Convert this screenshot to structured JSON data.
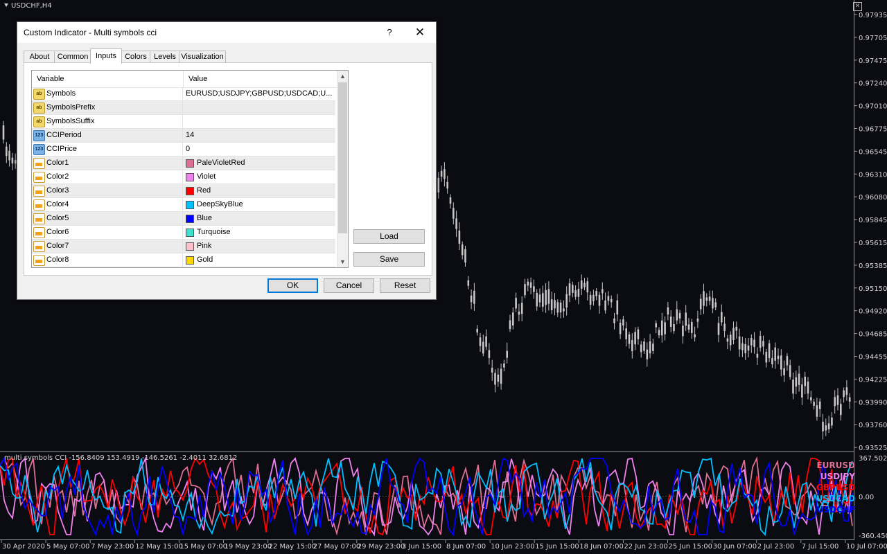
{
  "chart": {
    "symbol": "USDCHF,H4",
    "price_labels": [
      "0.97935",
      "0.97705",
      "0.97475",
      "0.97240",
      "0.97010",
      "0.96775",
      "0.96545",
      "0.96310",
      "0.96080",
      "0.95845",
      "0.95615",
      "0.95385",
      "0.95150",
      "0.94920",
      "0.94685",
      "0.94455",
      "0.94225",
      "0.93990",
      "0.93760",
      "0.93525"
    ],
    "date_labels": [
      "30 Apr 2020",
      "5 May 07:00",
      "7 May 23:00",
      "12 May 15:00",
      "15 May 07:00",
      "19 May 23:00",
      "22 May 15:00",
      "27 May 07:00",
      "29 May 23:00",
      "3 Jun 15:00",
      "8 Jun 07:00",
      "10 Jun 23:00",
      "15 Jun 15:00",
      "18 Jun 07:00",
      "22 Jun 23:00",
      "25 Jun 15:00",
      "30 Jun 07:00",
      "2 Jul 23:00",
      "7 Jul 15:00",
      "10 Jul 07:00"
    ],
    "indicator_label": "multi symbols CCI -156.8409 153.4919 -146.5261 -2.4011 32.6812",
    "indicator_scale": [
      "367.5023",
      "0.00",
      "-360.4502"
    ],
    "legend": [
      {
        "name": "EURUSD",
        "color": "#DB7093"
      },
      {
        "name": "USDJPY",
        "color": "#EE82EE"
      },
      {
        "name": "GBPUSD",
        "color": "#FF0000"
      },
      {
        "name": "USDCAD",
        "color": "#00BFFF"
      },
      {
        "name": "USDCHF",
        "color": "#0000FF"
      }
    ],
    "candle_color": "#c8c8c8"
  },
  "dialog": {
    "title": "Custom Indicator - Multi symbols cci",
    "help_label": "?",
    "close_label": "✕",
    "tabs": [
      {
        "label": "About",
        "active": false
      },
      {
        "label": "Common",
        "active": false
      },
      {
        "label": "Inputs",
        "active": true
      },
      {
        "label": "Colors",
        "active": false
      },
      {
        "label": "Levels",
        "active": false
      },
      {
        "label": "Visualization",
        "active": false
      }
    ],
    "grid": {
      "col_variable": "Variable",
      "col_value": "Value",
      "rows": [
        {
          "icon": "ab",
          "name": "Symbols",
          "value": "EURUSD;USDJPY;GBPUSD;USDCAD;U..."
        },
        {
          "icon": "ab",
          "name": "SymbolsPrefix",
          "value": ""
        },
        {
          "icon": "ab",
          "name": "SymbolsSuffix",
          "value": ""
        },
        {
          "icon": "num",
          "name": "CCIPeriod",
          "value": "14"
        },
        {
          "icon": "num",
          "name": "CCIPrice",
          "value": "0"
        },
        {
          "icon": "clr",
          "name": "Color1",
          "value": "PaleVioletRed",
          "swatch": "#DB7093"
        },
        {
          "icon": "clr",
          "name": "Color2",
          "value": "Violet",
          "swatch": "#EE82EE"
        },
        {
          "icon": "clr",
          "name": "Color3",
          "value": "Red",
          "swatch": "#FF0000"
        },
        {
          "icon": "clr",
          "name": "Color4",
          "value": "DeepSkyBlue",
          "swatch": "#00BFFF"
        },
        {
          "icon": "clr",
          "name": "Color5",
          "value": "Blue",
          "swatch": "#0000FF"
        },
        {
          "icon": "clr",
          "name": "Color6",
          "value": "Turquoise",
          "swatch": "#40E0D0"
        },
        {
          "icon": "clr",
          "name": "Color7",
          "value": "Pink",
          "swatch": "#FFC0CB"
        },
        {
          "icon": "clr",
          "name": "Color8",
          "value": "Gold",
          "swatch": "#FFD700"
        }
      ]
    },
    "load_label": "Load",
    "save_label": "Save",
    "ok_label": "OK",
    "cancel_label": "Cancel",
    "reset_label": "Reset"
  }
}
